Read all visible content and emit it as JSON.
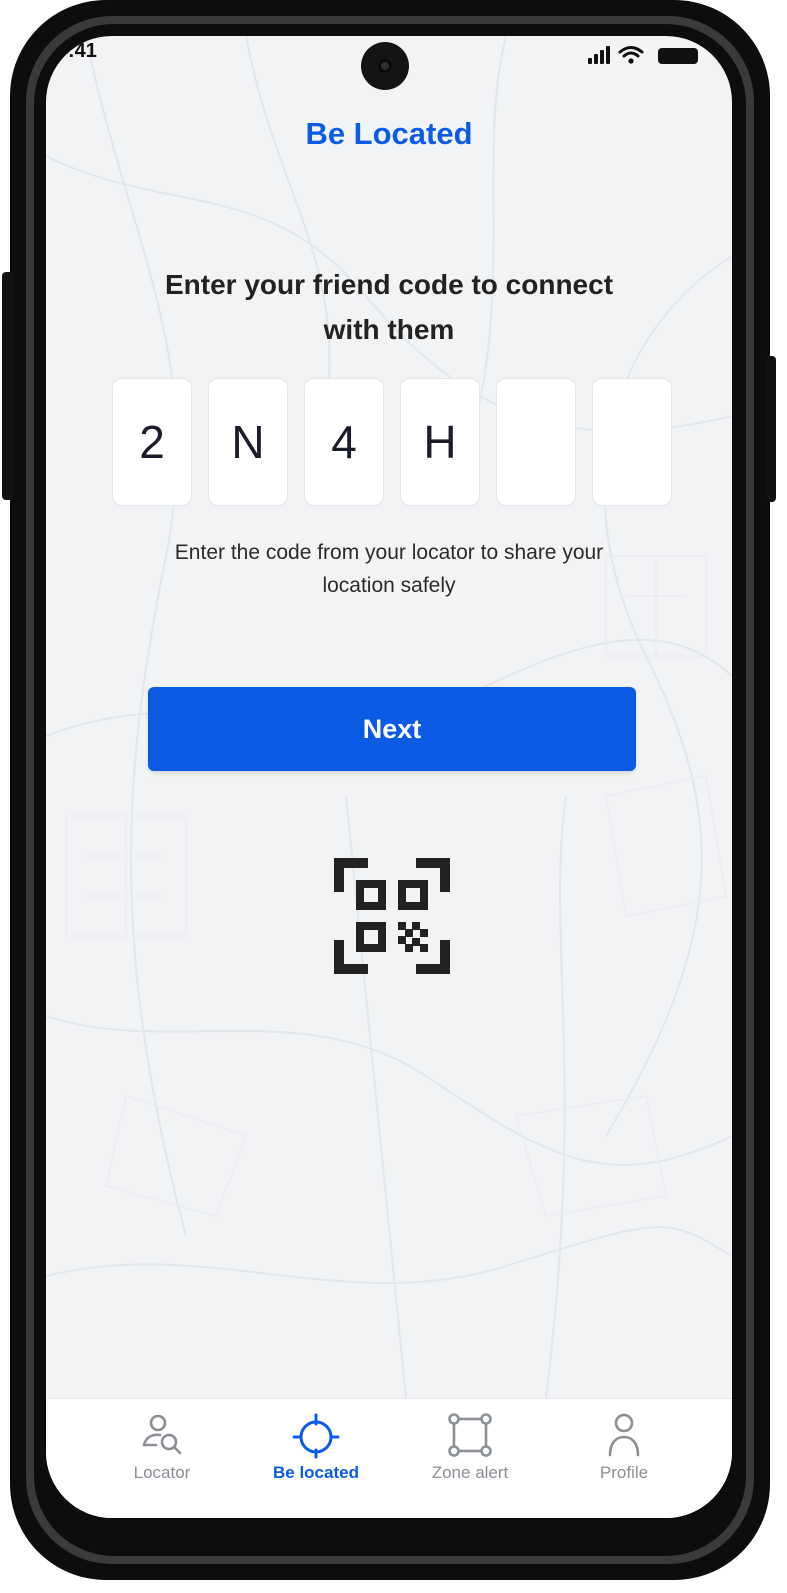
{
  "status_bar": {
    "time": ":41"
  },
  "header": {
    "title": "Be Located"
  },
  "prompt": {
    "line1": "Enter your friend code to connect",
    "line2": "with them"
  },
  "code": {
    "digits": [
      "2",
      "N",
      "4",
      "H",
      "",
      ""
    ]
  },
  "helper": {
    "line1": "Enter the code from your locator to share your",
    "line2": "location safely"
  },
  "actions": {
    "next_label": "Next"
  },
  "nav": {
    "items": [
      {
        "label": "Locator",
        "icon": "locator-icon",
        "active": false
      },
      {
        "label": "Be located",
        "icon": "crosshair-icon",
        "active": true
      },
      {
        "label": "Zone alert",
        "icon": "zone-icon",
        "active": false
      },
      {
        "label": "Profile",
        "icon": "profile-icon",
        "active": false
      }
    ]
  },
  "colors": {
    "accent": "#0b5ce4",
    "button": "#0a5ae3",
    "background": "#f1f3f5",
    "inactive_nav": "#8b8f96"
  }
}
